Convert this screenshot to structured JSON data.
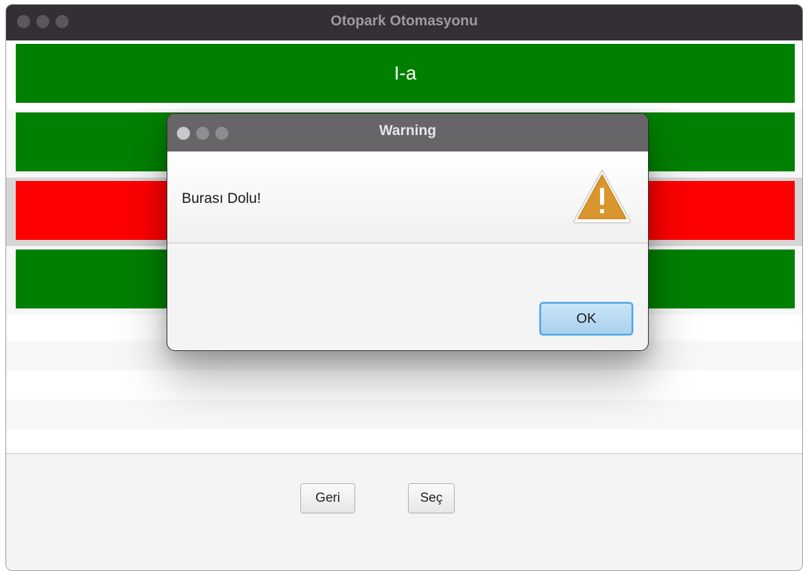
{
  "window": {
    "title": "Otopark Otomasyonu"
  },
  "slots": [
    {
      "label": "I-a",
      "status": "empty",
      "color": "#008000"
    },
    {
      "label": "",
      "status": "empty",
      "color": "#008000"
    },
    {
      "label": "",
      "status": "occupied",
      "color": "#ff0000"
    },
    {
      "label": "",
      "status": "empty",
      "color": "#008000"
    }
  ],
  "buttons": {
    "back": "Geri",
    "select": "Seç"
  },
  "dialog": {
    "title": "Warning",
    "message": "Burası Dolu!",
    "icon": "warning-icon",
    "ok": "OK"
  }
}
